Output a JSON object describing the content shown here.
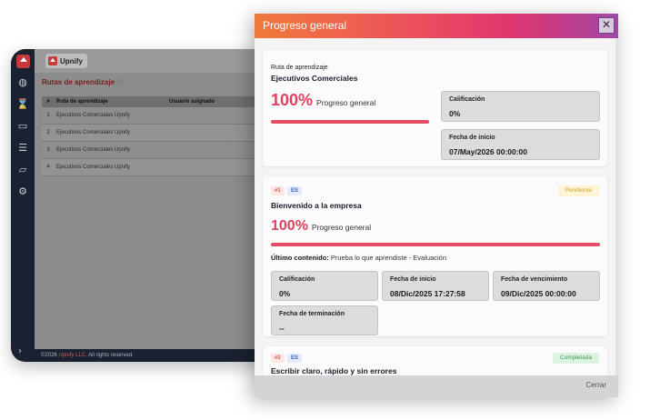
{
  "background_app": {
    "brand": "Upnify",
    "page_title": "Rutas de aprendizaje",
    "info_icon": "info-icon",
    "table": {
      "headers": [
        "#",
        "Ruta de aprendizaje",
        "Usuario asignado"
      ],
      "rows": [
        {
          "num": "1",
          "ruta": "Ejecutivos Comerciales Upnify"
        },
        {
          "num": "2",
          "ruta": "Ejecutivos Comerciales Upnify"
        },
        {
          "num": "3",
          "ruta": "Ejecutivos Comerciales Upnify"
        },
        {
          "num": "4",
          "ruta": "Ejecutivos Comerciales Upnify"
        }
      ]
    },
    "footer": {
      "prefix": "©2026 ",
      "link": "Upnify LLC.",
      "suffix": " All rights reserved."
    },
    "sidebar_icons": [
      "palette-icon",
      "hourglass-icon",
      "book-icon",
      "list-icon",
      "folder-icon",
      "gear-icon"
    ]
  },
  "modal": {
    "title": "Progreso general",
    "close_icon": "close-icon",
    "colors": {
      "accent": "#e0415e",
      "header_start": "#f07a3b",
      "header_end": "#a445a6"
    },
    "summary": {
      "route_label": "Ruta de aprendizaje",
      "route_name": "Ejecutivos Comerciales",
      "progress_pct": "100%",
      "progress_fraction": 1.0,
      "progress_caption": "Progreso general",
      "calificacion_label": "Calificación",
      "calificacion_value": "0%",
      "fecha_inicio_label": "Fecha de inicio",
      "fecha_inicio_value": "07/May/2026 00:00:00"
    },
    "courses": [
      {
        "num_tag": "#1",
        "lang_tag": "ES",
        "status": "Pendiente",
        "title": "Bienvenido a la empresa",
        "progress_pct": "100%",
        "progress_fraction": 1.0,
        "progress_caption": "Progreso general",
        "last_content_label": "Último contenido:",
        "last_content_value": " Prueba lo que aprendiste - Evaluación",
        "calificacion_label": "Calificación",
        "calificacion_value": "0%",
        "fecha_inicio_label": "Fecha de inicio",
        "fecha_inicio_value": "08/Dic/2025 17:27:58",
        "fecha_venc_label": "Fecha de vencimiento",
        "fecha_venc_value": "09/Dic/2025 00:00:00",
        "fecha_term_label": "Fecha de terminación",
        "fecha_term_value": "--"
      },
      {
        "num_tag": "#2",
        "lang_tag": "ES",
        "status": "Completada",
        "title": "Escribir claro, rápido y sin errores"
      }
    ],
    "footer": {
      "close_label": "Cerrar"
    }
  }
}
